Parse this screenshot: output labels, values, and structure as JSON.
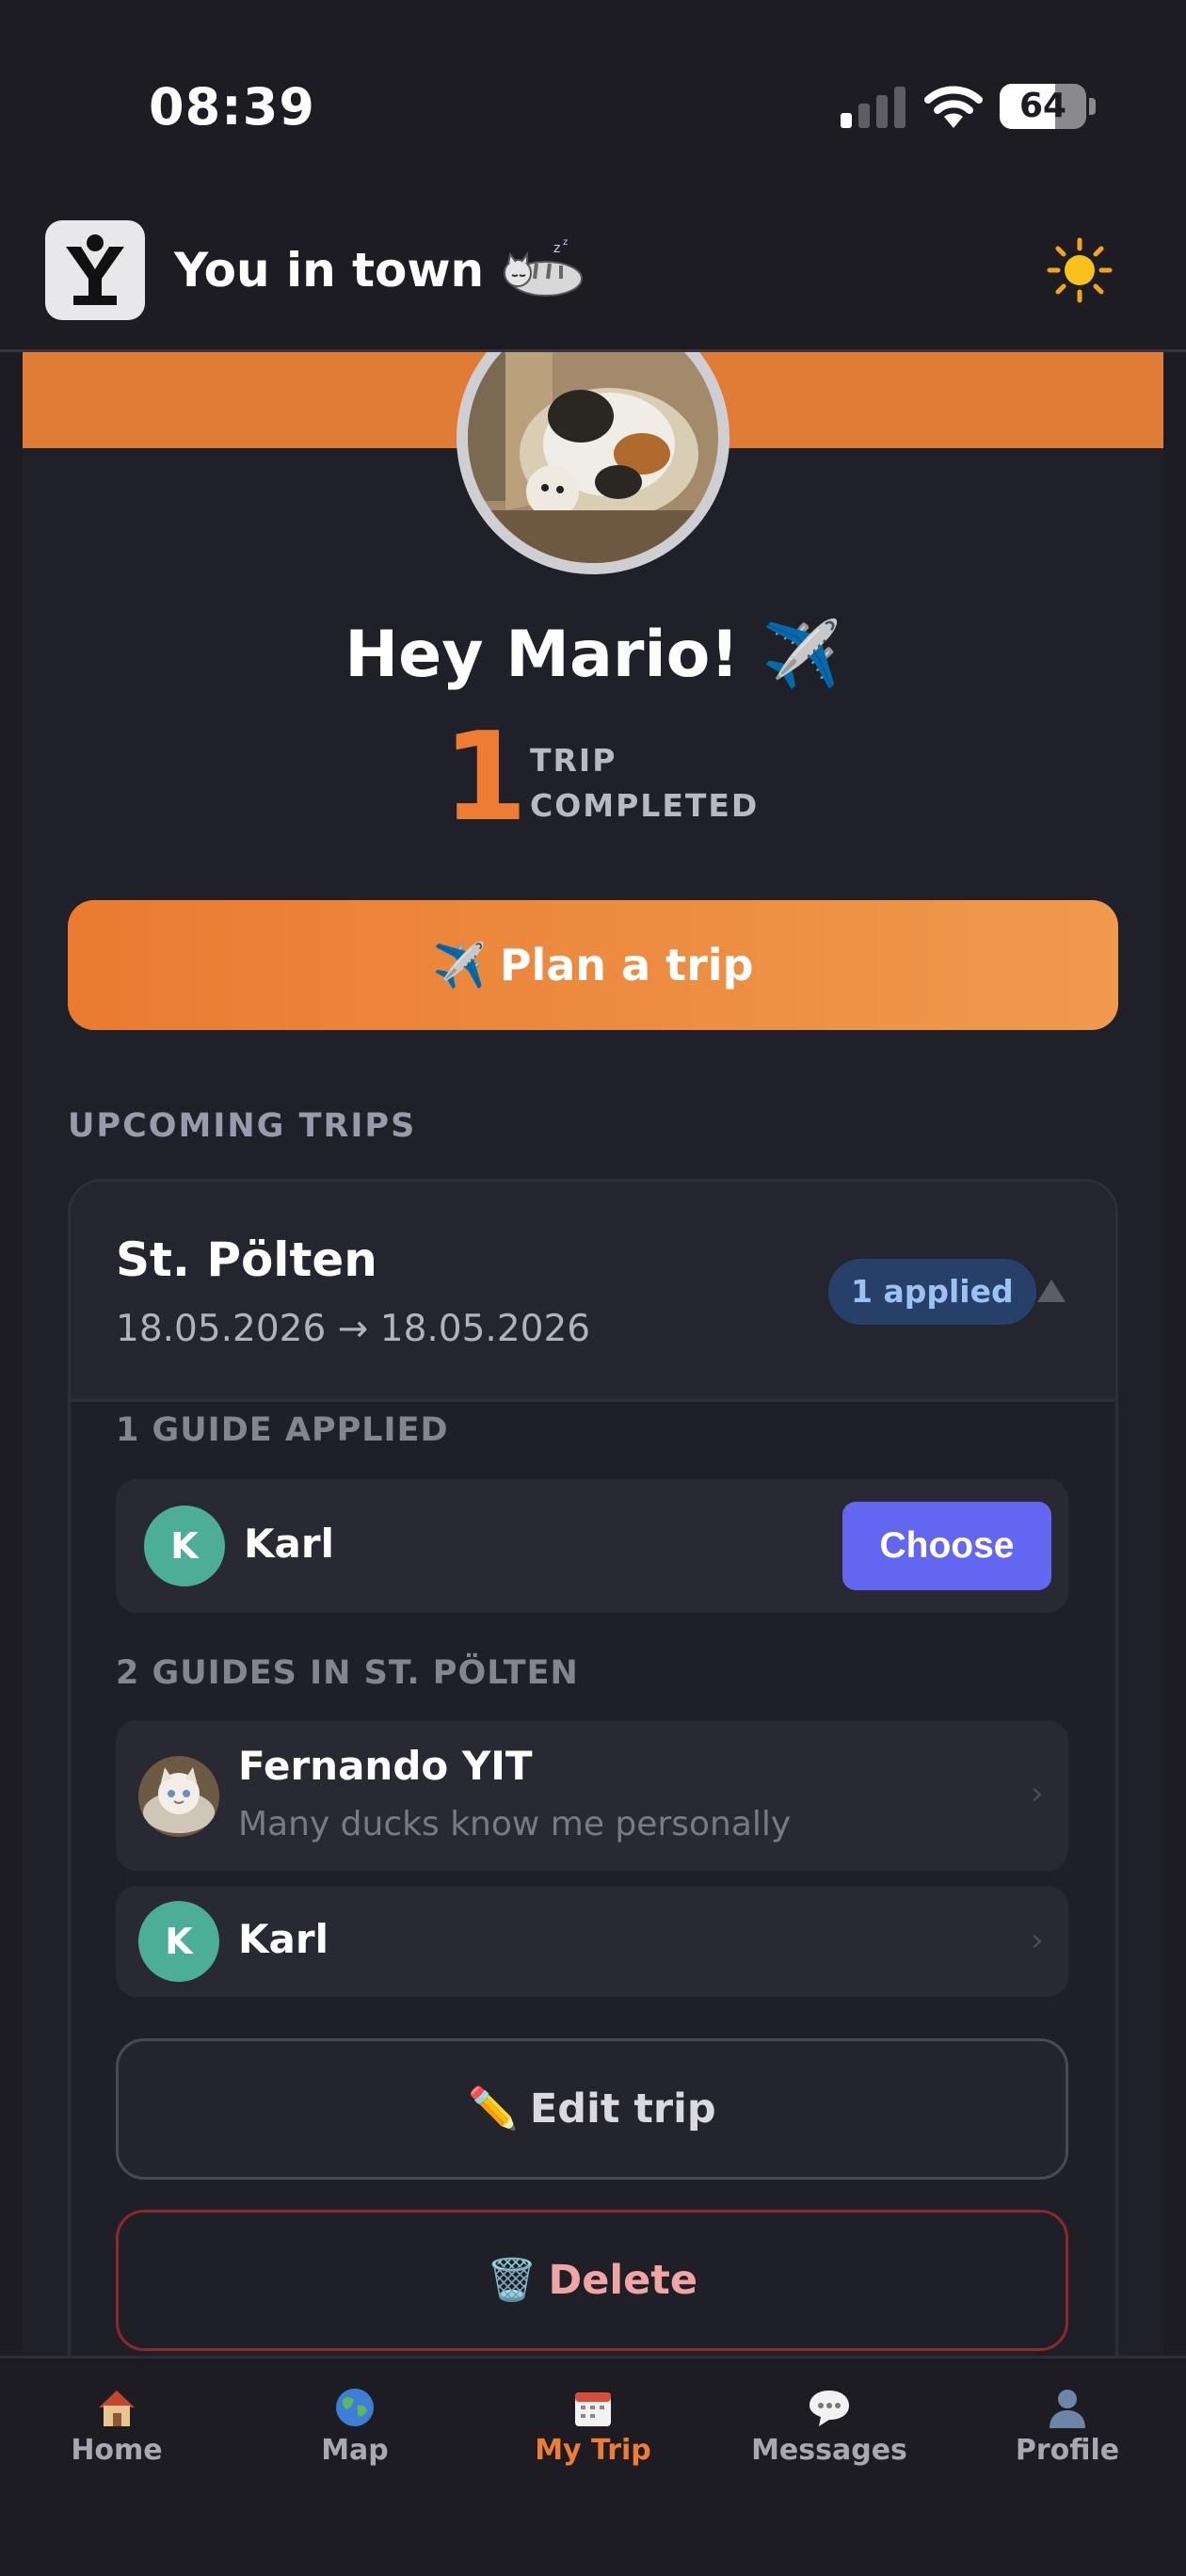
{
  "status": {
    "time": "08:39",
    "battery_percent": 64,
    "battery_label": "64"
  },
  "header": {
    "app_title": "You in town",
    "logo_letter": "Y"
  },
  "profile": {
    "greeting": "Hey Mario! ✈️",
    "trips_completed_count": "1",
    "trips_completed_label_1": "TRIP",
    "trips_completed_label_2": "COMPLETED"
  },
  "plan_button": {
    "emoji": "✈️",
    "label": "Plan a trip"
  },
  "upcoming": {
    "section_title": "UPCOMING TRIPS",
    "trip": {
      "city": "St. Pölten",
      "dates": "18.05.2026 → 18.05.2026",
      "applied_badge": "1 applied",
      "applied_section_title": "1 GUIDE APPLIED",
      "applied_guides": [
        {
          "initial": "K",
          "name": "Karl",
          "action_label": "Choose"
        }
      ],
      "city_guides_title": "2 GUIDES IN ST. PÖLTEN",
      "city_guides": [
        {
          "name": "Fernando YIT",
          "tagline": "Many ducks know me personally",
          "chevron": "›"
        },
        {
          "initial": "K",
          "name": "Karl",
          "chevron": "›"
        }
      ],
      "edit_emoji": "✏️",
      "edit_label": "Edit trip",
      "delete_emoji": "🗑️",
      "delete_label": "Delete"
    }
  },
  "tabs": [
    {
      "label": "Home",
      "icon": "house-icon",
      "active": false
    },
    {
      "label": "Map",
      "icon": "globe-icon",
      "active": false
    },
    {
      "label": "My Trip",
      "icon": "calendar-icon",
      "active": true
    },
    {
      "label": "Messages",
      "icon": "speech-bubble-icon",
      "active": false
    },
    {
      "label": "Profile",
      "icon": "person-icon",
      "active": false
    }
  ],
  "colors": {
    "accent": "#ee7d33",
    "cover": "#e07c35",
    "choose_button": "#6366f1",
    "guide_avatar": "#4cae98",
    "badge_bg": "#27406a",
    "badge_text": "#9cc1f5",
    "background": "#1c1c22"
  }
}
